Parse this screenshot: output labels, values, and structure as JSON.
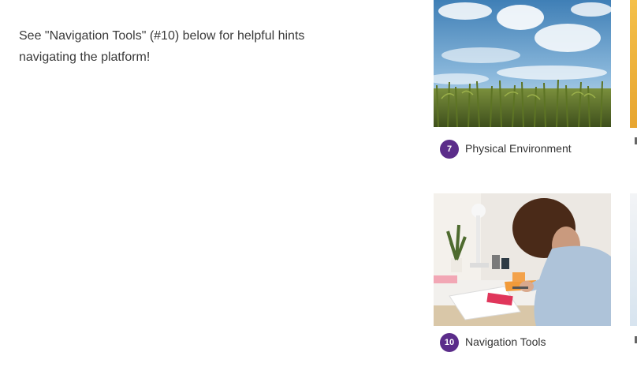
{
  "intro": {
    "text": "See \"Navigation Tools\" (#10) below for helpful hints navigating the platform!"
  },
  "cards": [
    {
      "number": "7",
      "label": "Physical Environment",
      "image": "cornfield-sky-photo"
    },
    {
      "number": "10",
      "label": "Navigation Tools",
      "image": "woman-at-desk-photo"
    }
  ],
  "colors": {
    "badge": "#5b2c8a",
    "text": "#333333"
  }
}
